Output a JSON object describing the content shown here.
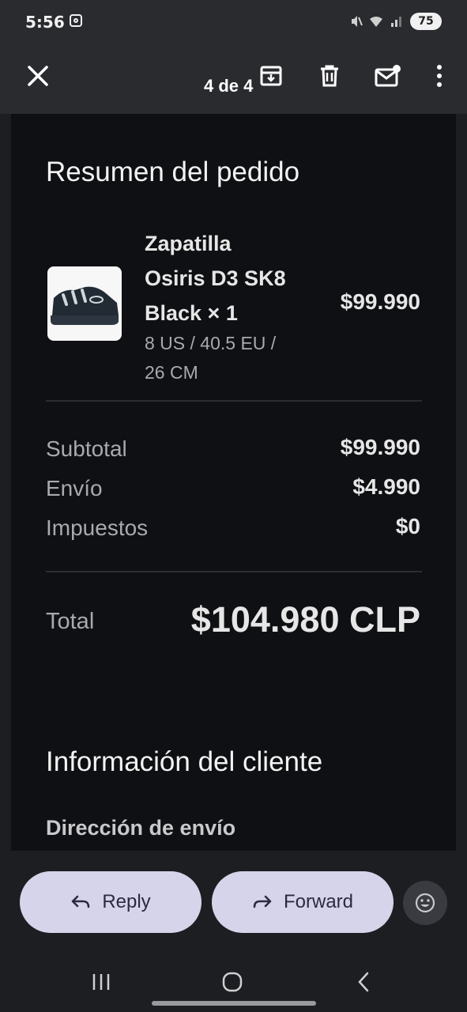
{
  "status_bar": {
    "time": "5:56",
    "battery": "75"
  },
  "toolbar": {
    "counter": "4 de 4"
  },
  "order_summary": {
    "title": "Resumen del pedido",
    "product": {
      "name_lines": [
        "Zapatilla",
        "Osiris D3 SK8",
        "Black × 1"
      ],
      "variant_lines": [
        "8 US / 40.5 EU /",
        "26 CM"
      ],
      "price": "$99.990"
    },
    "rows": [
      {
        "label": "Subtotal",
        "value": "$99.990"
      },
      {
        "label": "Envío",
        "value": "$4.990"
      },
      {
        "label": "Impuestos",
        "value": "$0"
      }
    ],
    "total_label": "Total",
    "total_value": "$104.980 CLP"
  },
  "customer_info": {
    "title": "Información del cliente",
    "shipping_heading": "Dirección de envío"
  },
  "actions": {
    "reply_label": "Reply",
    "forward_label": "Forward"
  },
  "icons": {
    "close": "close-icon",
    "archive": "archive-icon",
    "delete": "trash-icon",
    "mark_unread": "mail-unread-icon",
    "more": "more-vert-icon",
    "reply": "reply-arrow-icon",
    "forward": "forward-arrow-icon",
    "emoji": "emoji-icon"
  },
  "colors": {
    "background": "#1c1e22",
    "email_body": "#0f1013",
    "pill": "#d6d4ea"
  }
}
